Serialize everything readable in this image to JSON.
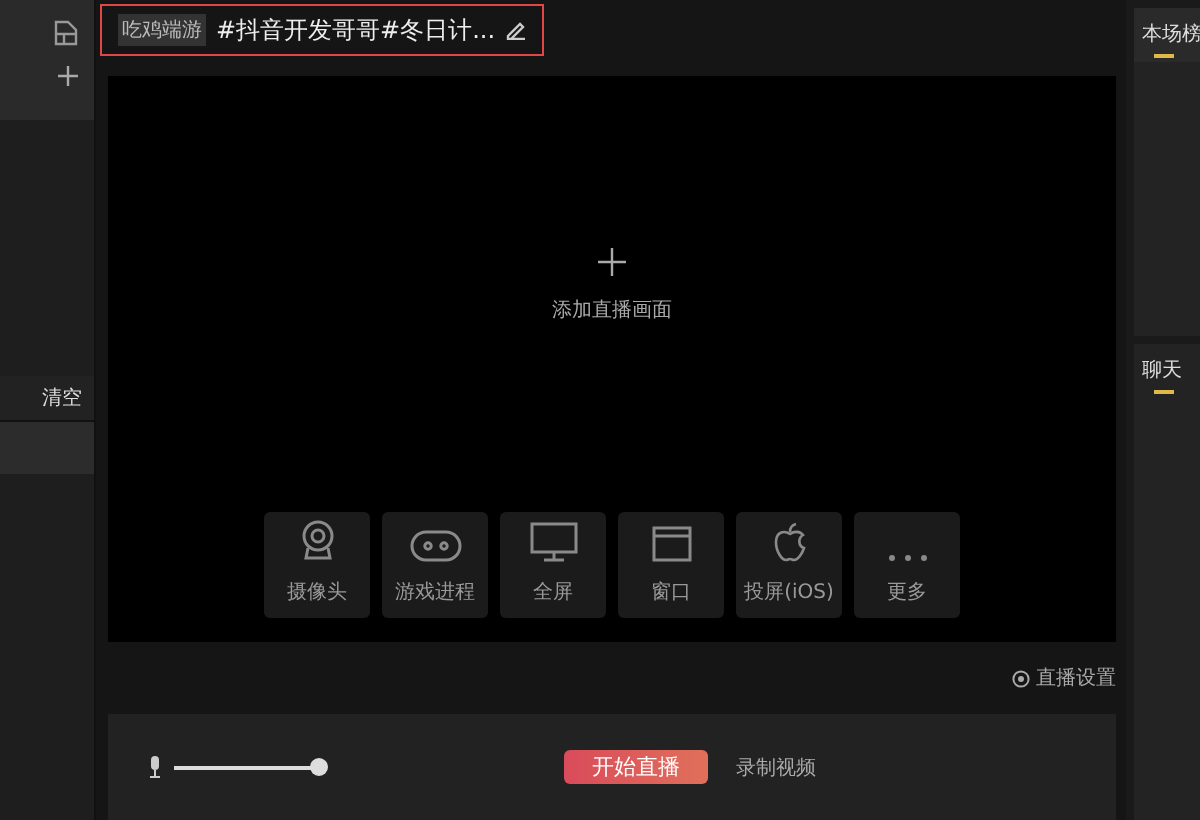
{
  "sidebar": {
    "clear_button": "清空"
  },
  "title_bar": {
    "category_tag": "吃鸡端游",
    "title": "#抖音开发哥哥#冬日计..."
  },
  "preview": {
    "add_label": "添加直播画面"
  },
  "sources": [
    {
      "kind": "camera",
      "label": "摄像头"
    },
    {
      "kind": "game",
      "label": "游戏进程"
    },
    {
      "kind": "monitor",
      "label": "全屏"
    },
    {
      "kind": "window",
      "label": "窗口"
    },
    {
      "kind": "apple",
      "label": "投屏(iOS)"
    },
    {
      "kind": "more",
      "label": "更多"
    }
  ],
  "settings_link": "直播设置",
  "controls": {
    "mic": {
      "level": 1
    },
    "start_button": "开始直播",
    "record_button": "录制视频"
  },
  "side_panels": [
    {
      "title": "本场榜",
      "selected": true
    },
    {
      "title": "聊天",
      "selected": true
    }
  ]
}
